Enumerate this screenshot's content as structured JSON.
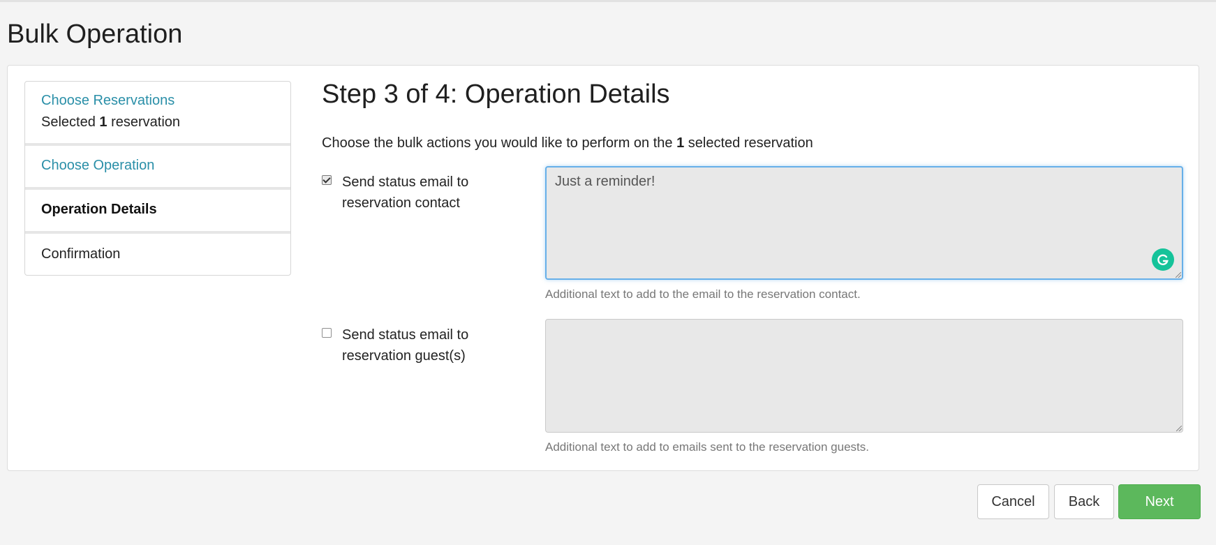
{
  "page": {
    "title": "Bulk Operation"
  },
  "steps": {
    "step1": {
      "label": "Choose Reservations",
      "sub_prefix": "Selected",
      "sub_count": "1",
      "sub_suffix": "reservation"
    },
    "step2": {
      "label": "Choose Operation"
    },
    "step3": {
      "label": "Operation Details"
    },
    "step4": {
      "label": "Confirmation"
    }
  },
  "main": {
    "heading": "Step 3 of 4: Operation Details",
    "intro_prefix": "Choose the bulk actions you would like to perform on the",
    "intro_count": "1",
    "intro_suffix": "selected reservation",
    "contact": {
      "checked": true,
      "label_line1": "Send status email to",
      "label_line2": "reservation contact",
      "text": "Just a reminder!",
      "help": "Additional text to add to the email to the reservation contact."
    },
    "guests": {
      "checked": false,
      "label_line1": "Send status email to",
      "label_line2": "reservation guest(s)",
      "text": "",
      "help": "Additional text to add to emails sent to the reservation guests."
    }
  },
  "actions": {
    "cancel": "Cancel",
    "back": "Back",
    "next": "Next"
  },
  "colors": {
    "link": "#2a8fa8",
    "primary": "#5cb85c",
    "focus": "#66afe9",
    "grammarly": "#15c39a"
  }
}
